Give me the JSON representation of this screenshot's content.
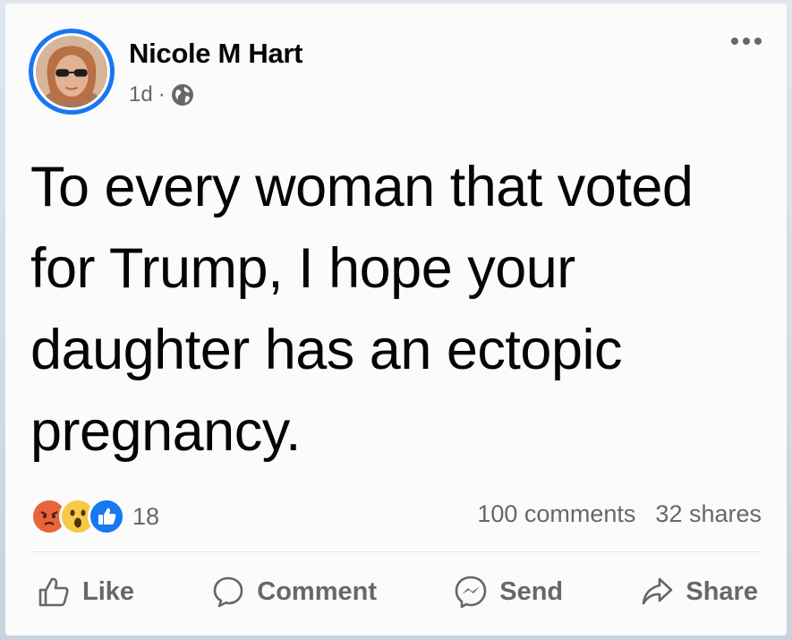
{
  "post": {
    "author": "Nicole M Hart",
    "time": "1d",
    "separator": "·",
    "privacy_icon": "globe-icon",
    "text": "To every woman that voted for Trump, I hope your daughter has an ectopic pregnancy.",
    "reaction_icons": [
      "angry-reaction-icon",
      "wow-reaction-icon",
      "like-reaction-icon"
    ],
    "reaction_count": "18",
    "comments": "100 comments",
    "shares": "32 shares"
  },
  "actions": {
    "like": "Like",
    "comment": "Comment",
    "send": "Send",
    "share": "Share"
  },
  "colors": {
    "accent": "#1877f2",
    "secondary_text": "#65676b",
    "primary_text": "#050505",
    "angry": "#e8643c",
    "wow": "#f7c944"
  }
}
